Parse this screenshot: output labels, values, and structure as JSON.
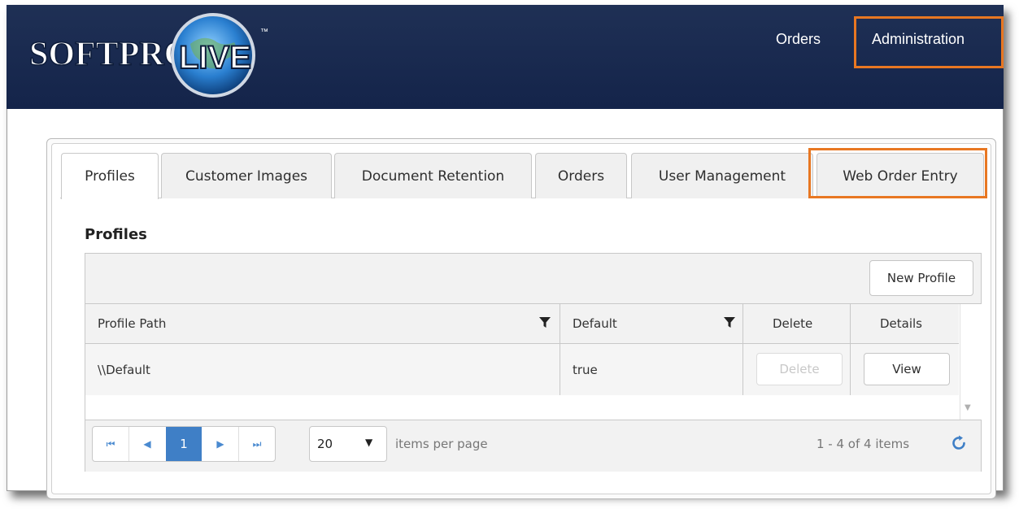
{
  "header": {
    "logo_text": "SOFTPRO LIVE",
    "nav": {
      "orders": "Orders",
      "administration": "Administration"
    }
  },
  "tabs": [
    {
      "label": "Profiles",
      "active": true
    },
    {
      "label": "Customer Images"
    },
    {
      "label": "Document Retention"
    },
    {
      "label": "Orders"
    },
    {
      "label": "User Management"
    },
    {
      "label": "Web Order Entry"
    }
  ],
  "section": {
    "title": "Profiles"
  },
  "grid": {
    "toolbar": {
      "new_profile": "New Profile"
    },
    "columns": {
      "profile_path": "Profile Path",
      "default": "Default",
      "delete": "Delete",
      "details": "Details"
    },
    "rows": [
      {
        "profile_path": "\\\\Default",
        "default": "true",
        "delete": "Delete",
        "details": "View"
      }
    ],
    "pager": {
      "current_page": "1",
      "page_size": "20",
      "items_per_page": "items per page",
      "range": "1 - 4 of 4 items"
    }
  },
  "colors": {
    "header_bg": "#1b2b50",
    "highlight": "#e87722",
    "pager_active": "#3f7fc6"
  }
}
